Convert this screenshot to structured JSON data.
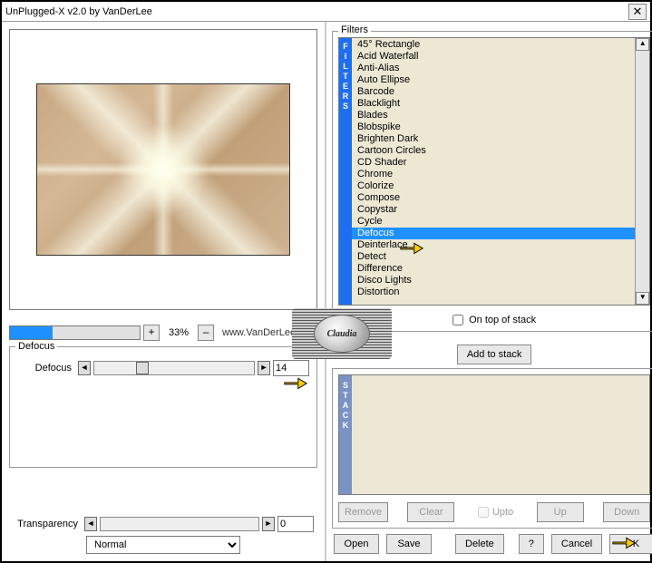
{
  "window": {
    "title": "UnPlugged-X v2.0 by VanDerLee"
  },
  "zoom": {
    "percent": "33%",
    "url": "www.VanDerLee.com",
    "plus": "+",
    "minus": "–"
  },
  "param_group": {
    "legend": "Defocus"
  },
  "param": {
    "label": "Defocus",
    "value": "14"
  },
  "transparency": {
    "label": "Transparency",
    "value": "0"
  },
  "blend": {
    "value": "Normal"
  },
  "filters": {
    "legend": "Filters",
    "items": [
      "45° Rectangle",
      "Acid Waterfall",
      "Anti-Alias",
      "Auto Ellipse",
      "Barcode",
      "Blacklight",
      "Blades",
      "Blobspike",
      "Brighten Dark",
      "Cartoon Circles",
      "CD Shader",
      "Chrome",
      "Colorize",
      "Compose",
      "Copystar",
      "Cycle",
      "Defocus",
      "Deinterlace",
      "Detect",
      "Difference",
      "Disco Lights",
      "Distortion"
    ],
    "selectedIndex": 16,
    "on_top": "On top of stack"
  },
  "stack": {
    "add": "Add to stack",
    "remove": "Remove",
    "clear": "Clear",
    "upto": "Upto",
    "up": "Up",
    "down": "Down"
  },
  "buttons": {
    "open": "Open",
    "save": "Save",
    "delete": "Delete",
    "help": "?",
    "cancel": "Cancel",
    "ok": "OK"
  },
  "watermark": "Claudia"
}
